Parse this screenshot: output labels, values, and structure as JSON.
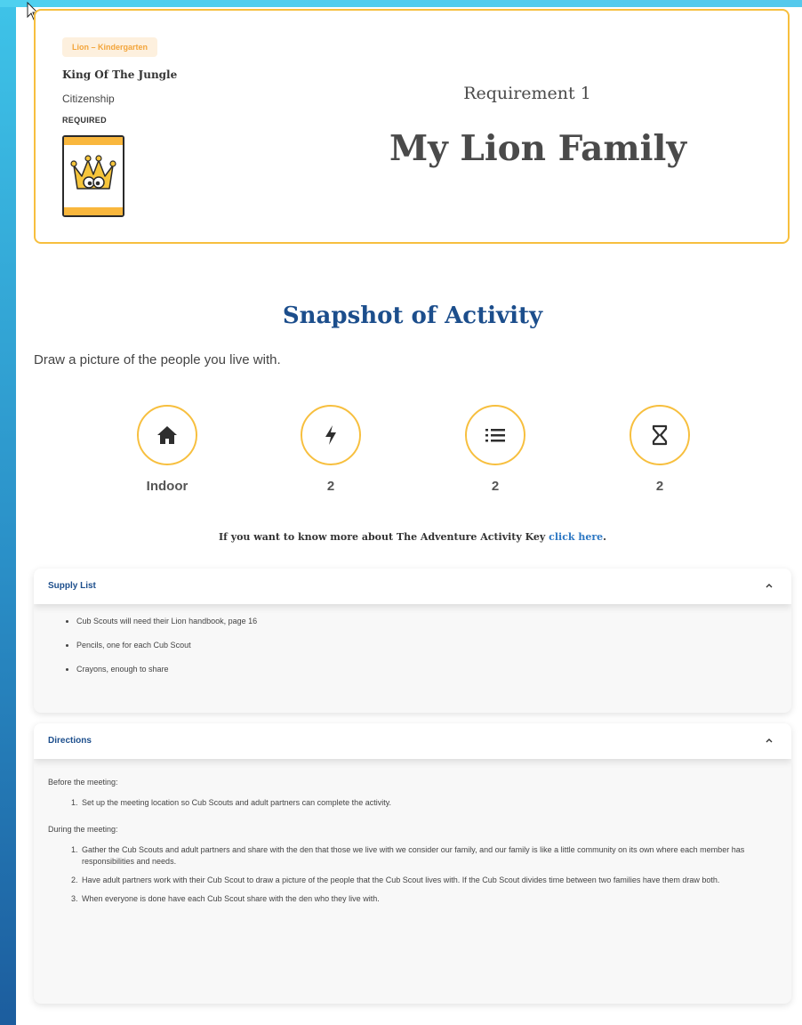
{
  "header": {
    "rank_badge": "Lion – Kindergarten",
    "adventure_name": "King Of The Jungle",
    "category": "Citizenship",
    "required_label": "REQUIRED",
    "requirement_label": "Requirement 1",
    "requirement_title": "My Lion Family"
  },
  "snapshot": {
    "title": "Snapshot of Activity",
    "description": "Draw a picture of the people you live with.",
    "keys": [
      {
        "icon": "home-icon",
        "label": "Indoor"
      },
      {
        "icon": "lightning-icon",
        "label": "2"
      },
      {
        "icon": "list-icon",
        "label": "2"
      },
      {
        "icon": "hourglass-icon",
        "label": "2"
      }
    ],
    "more_info_text": "If you want to know more about The Adventure Activity Key ",
    "more_info_link": "click here",
    "more_info_end": "."
  },
  "supply": {
    "title": "Supply List",
    "items": [
      "Cub Scouts will need their Lion handbook, page 16",
      "Pencils, one for each Cub Scout",
      "Crayons, enough to share"
    ]
  },
  "directions": {
    "title": "Directions",
    "before_label": "Before the meeting:",
    "before_steps": [
      "Set up the meeting location so Cub Scouts and adult partners can complete the activity."
    ],
    "during_label": "During the meeting:",
    "during_steps": [
      "Gather the Cub Scouts and adult partners and share with the den that those we live with we consider our family, and our family is like a little community on its own where each member has responsibilities and needs.",
      "Have adult partners work with their Cub Scout to draw a picture of the people that the Cub Scout lives with.  If the Cub Scout divides time between two families have them draw both.",
      "When everyone is done have each Cub Scout share with the den who they live with."
    ]
  },
  "colors": {
    "accent": "#f7bf3e",
    "heading_blue": "#1c4e8c",
    "link_blue": "#2d78c4"
  }
}
